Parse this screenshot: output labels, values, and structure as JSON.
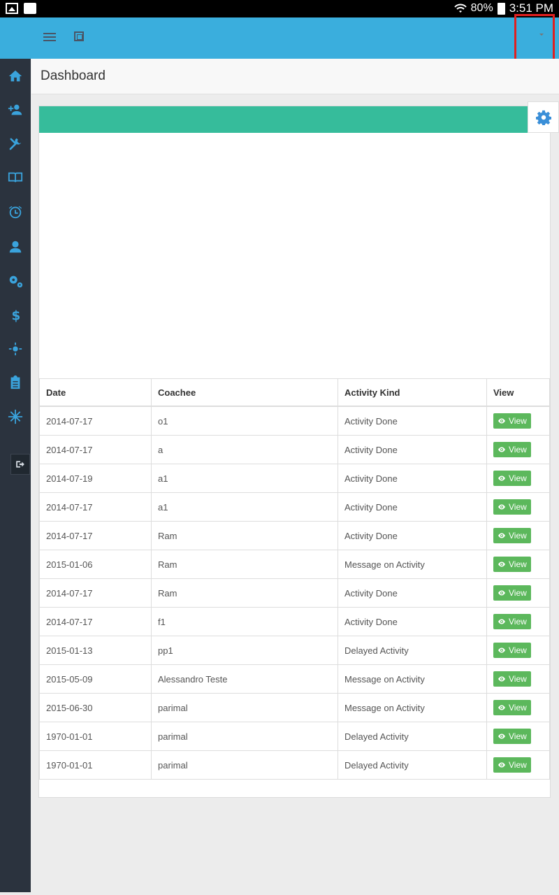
{
  "status_bar": {
    "battery": "80%",
    "time": "3:51 PM"
  },
  "page": {
    "title": "Dashboard"
  },
  "table": {
    "headers": [
      "Date",
      "Coachee",
      "Activity Kind",
      "View"
    ],
    "view_label": "View",
    "rows": [
      [
        "2014-07-17",
        "o1",
        "Activity Done"
      ],
      [
        "2014-07-17",
        "a",
        "Activity Done"
      ],
      [
        "2014-07-19",
        "a1",
        "Activity Done"
      ],
      [
        "2014-07-17",
        "a1",
        "Activity Done"
      ],
      [
        "2014-07-17",
        "Ram",
        "Activity Done"
      ],
      [
        "2015-01-06",
        "Ram",
        "Message on Activity"
      ],
      [
        "2014-07-17",
        "Ram",
        "Activity Done"
      ],
      [
        "2014-07-17",
        "f1",
        "Activity Done"
      ],
      [
        "2015-01-13",
        "pp1",
        "Delayed Activity"
      ],
      [
        "2015-05-09",
        "Alessandro Teste",
        "Message on Activity"
      ],
      [
        "2015-06-30",
        "parimal",
        "Message on Activity"
      ],
      [
        "1970-01-01",
        "parimal",
        "Delayed Activity"
      ],
      [
        "1970-01-01",
        "parimal",
        "Delayed Activity"
      ]
    ]
  },
  "sidebar": {
    "items": [
      {
        "name": "home-icon"
      },
      {
        "name": "add-user-icon"
      },
      {
        "name": "tools-icon"
      },
      {
        "name": "book-icon"
      },
      {
        "name": "alarm-clock-icon"
      },
      {
        "name": "user-icon"
      },
      {
        "name": "gears-icon"
      },
      {
        "name": "dollar-icon"
      },
      {
        "name": "sun-icon"
      },
      {
        "name": "clipboard-icon"
      },
      {
        "name": "snowflake-icon"
      }
    ]
  },
  "colors": {
    "header": "#3aaedd",
    "sidebar": "#2b333e",
    "panel_head": "#36bc9b",
    "view_button": "#5cb85c"
  }
}
